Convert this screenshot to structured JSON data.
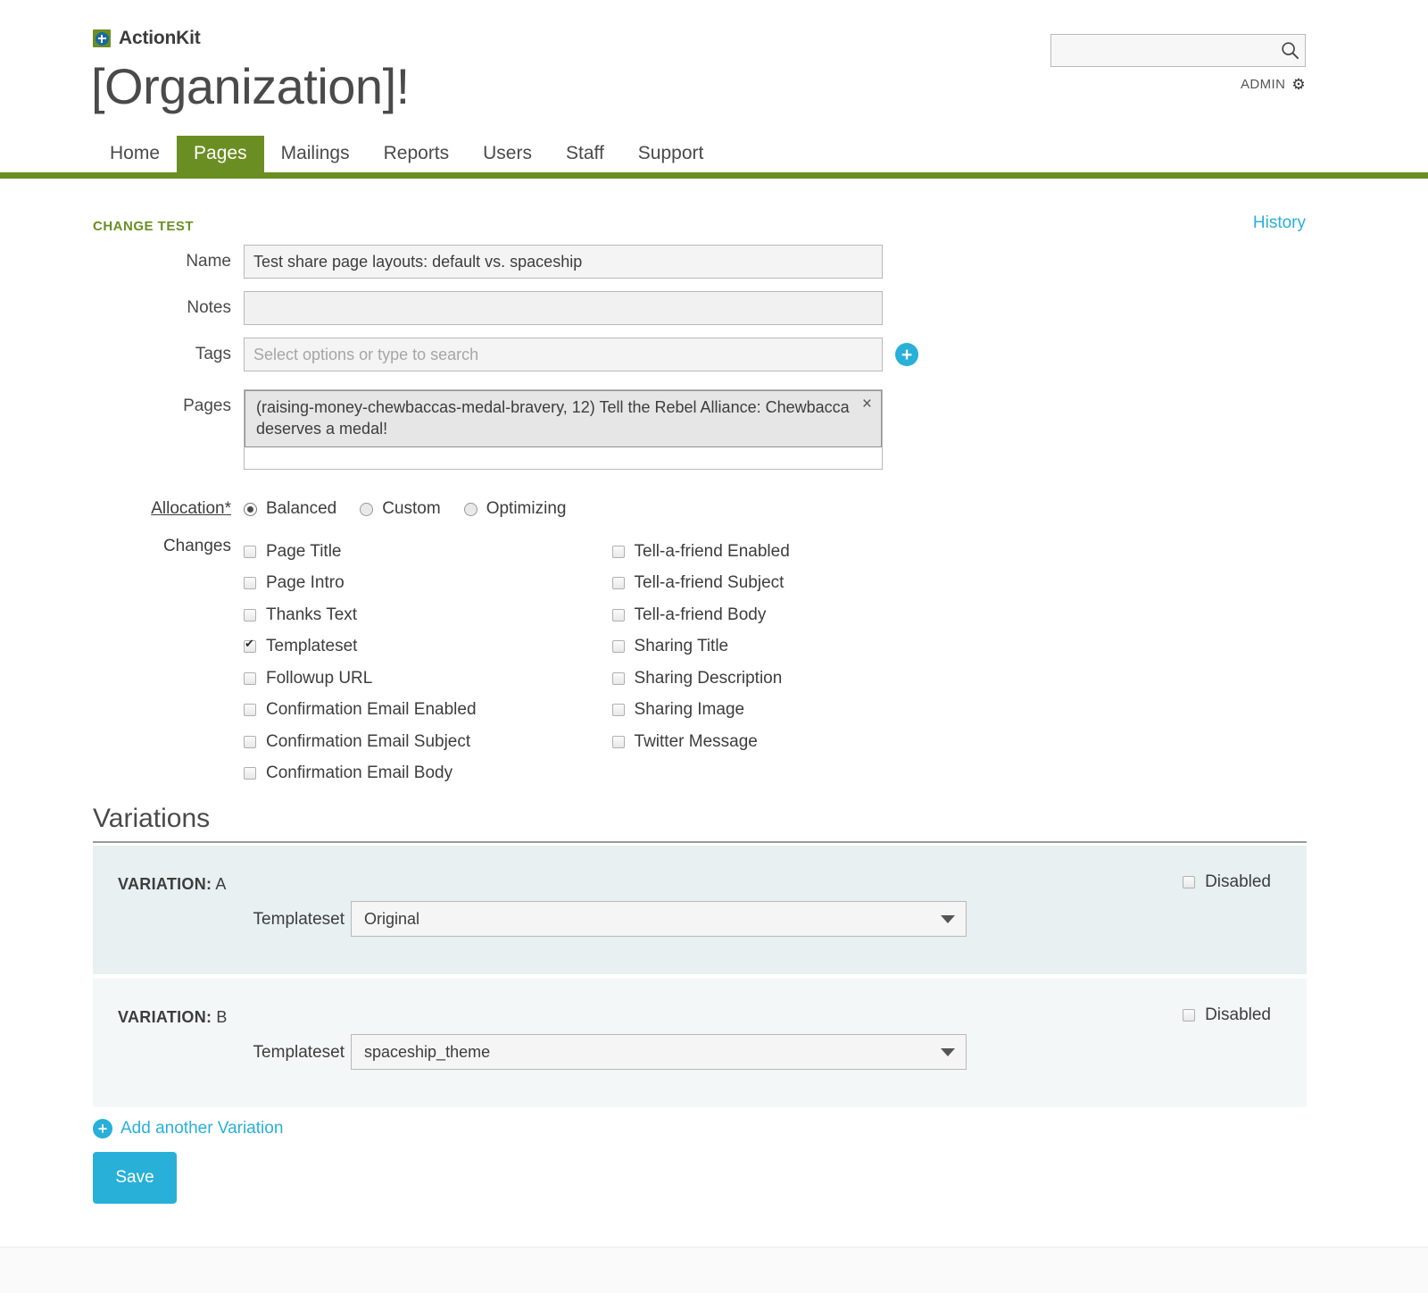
{
  "brand": {
    "name": "ActionKit",
    "logo_icon": "plus-square-icon"
  },
  "header": {
    "org_title": "[Organization]!",
    "search": {
      "value": "",
      "placeholder": "",
      "icon": "search-icon"
    },
    "admin": {
      "label": "ADMIN",
      "icon": "gear-icon"
    }
  },
  "nav": {
    "items": [
      {
        "label": "Home",
        "active": false
      },
      {
        "label": "Pages",
        "active": true
      },
      {
        "label": "Mailings",
        "active": false
      },
      {
        "label": "Reports",
        "active": false
      },
      {
        "label": "Users",
        "active": false
      },
      {
        "label": "Staff",
        "active": false
      },
      {
        "label": "Support",
        "active": false
      }
    ]
  },
  "section": {
    "title": "CHANGE TEST",
    "history_link": "History"
  },
  "form": {
    "name": {
      "label": "Name",
      "value": "Test share page layouts: default vs. spaceship"
    },
    "notes": {
      "label": "Notes",
      "value": ""
    },
    "tags": {
      "label": "Tags",
      "value": "",
      "placeholder": "Select options or type to search",
      "add_icon": "plus-circle-icon"
    },
    "pages": {
      "label": "Pages",
      "chip": "(raising-money-chewbaccas-medal-bravery, 12) Tell the Rebel Alliance: Chewbacca deserves a medal!",
      "chip_remove_icon": "close-icon"
    },
    "allocation": {
      "label": "Allocation*",
      "options": [
        {
          "label": "Balanced",
          "selected": true
        },
        {
          "label": "Custom",
          "selected": false
        },
        {
          "label": "Optimizing",
          "selected": false
        }
      ]
    },
    "changes": {
      "label": "Changes",
      "left_column": [
        {
          "label": "Page Title",
          "checked": false
        },
        {
          "label": "Page Intro",
          "checked": false
        },
        {
          "label": "Thanks Text",
          "checked": false
        },
        {
          "label": "Templateset",
          "checked": true
        },
        {
          "label": "Followup URL",
          "checked": false
        },
        {
          "label": "Confirmation Email Enabled",
          "checked": false
        },
        {
          "label": "Confirmation Email Subject",
          "checked": false
        },
        {
          "label": "Confirmation Email Body",
          "checked": false
        }
      ],
      "right_column": [
        {
          "label": "Tell-a-friend Enabled",
          "checked": false
        },
        {
          "label": "Tell-a-friend Subject",
          "checked": false
        },
        {
          "label": "Tell-a-friend Body",
          "checked": false
        },
        {
          "label": "Sharing Title",
          "checked": false
        },
        {
          "label": "Sharing Description",
          "checked": false
        },
        {
          "label": "Sharing Image",
          "checked": false
        },
        {
          "label": "Twitter Message",
          "checked": false
        }
      ]
    }
  },
  "variations": {
    "heading": "Variations",
    "items": [
      {
        "prefix": "VARIATION:",
        "letter": "A",
        "templateset_label": "Templateset",
        "templateset_value": "Original",
        "disabled_label": "Disabled",
        "disabled_checked": false
      },
      {
        "prefix": "VARIATION:",
        "letter": "B",
        "templateset_label": "Templateset",
        "templateset_value": "spaceship_theme",
        "disabled_label": "Disabled",
        "disabled_checked": false
      }
    ],
    "add_label": "Add another Variation",
    "add_icon": "plus-circle-icon"
  },
  "actions": {
    "save_label": "Save"
  },
  "colors": {
    "brand_green": "#6b8e23",
    "accent_blue": "#29b0d9",
    "variation_a_bg": "#e8f0f1",
    "variation_b_bg": "#f4f7f7"
  }
}
